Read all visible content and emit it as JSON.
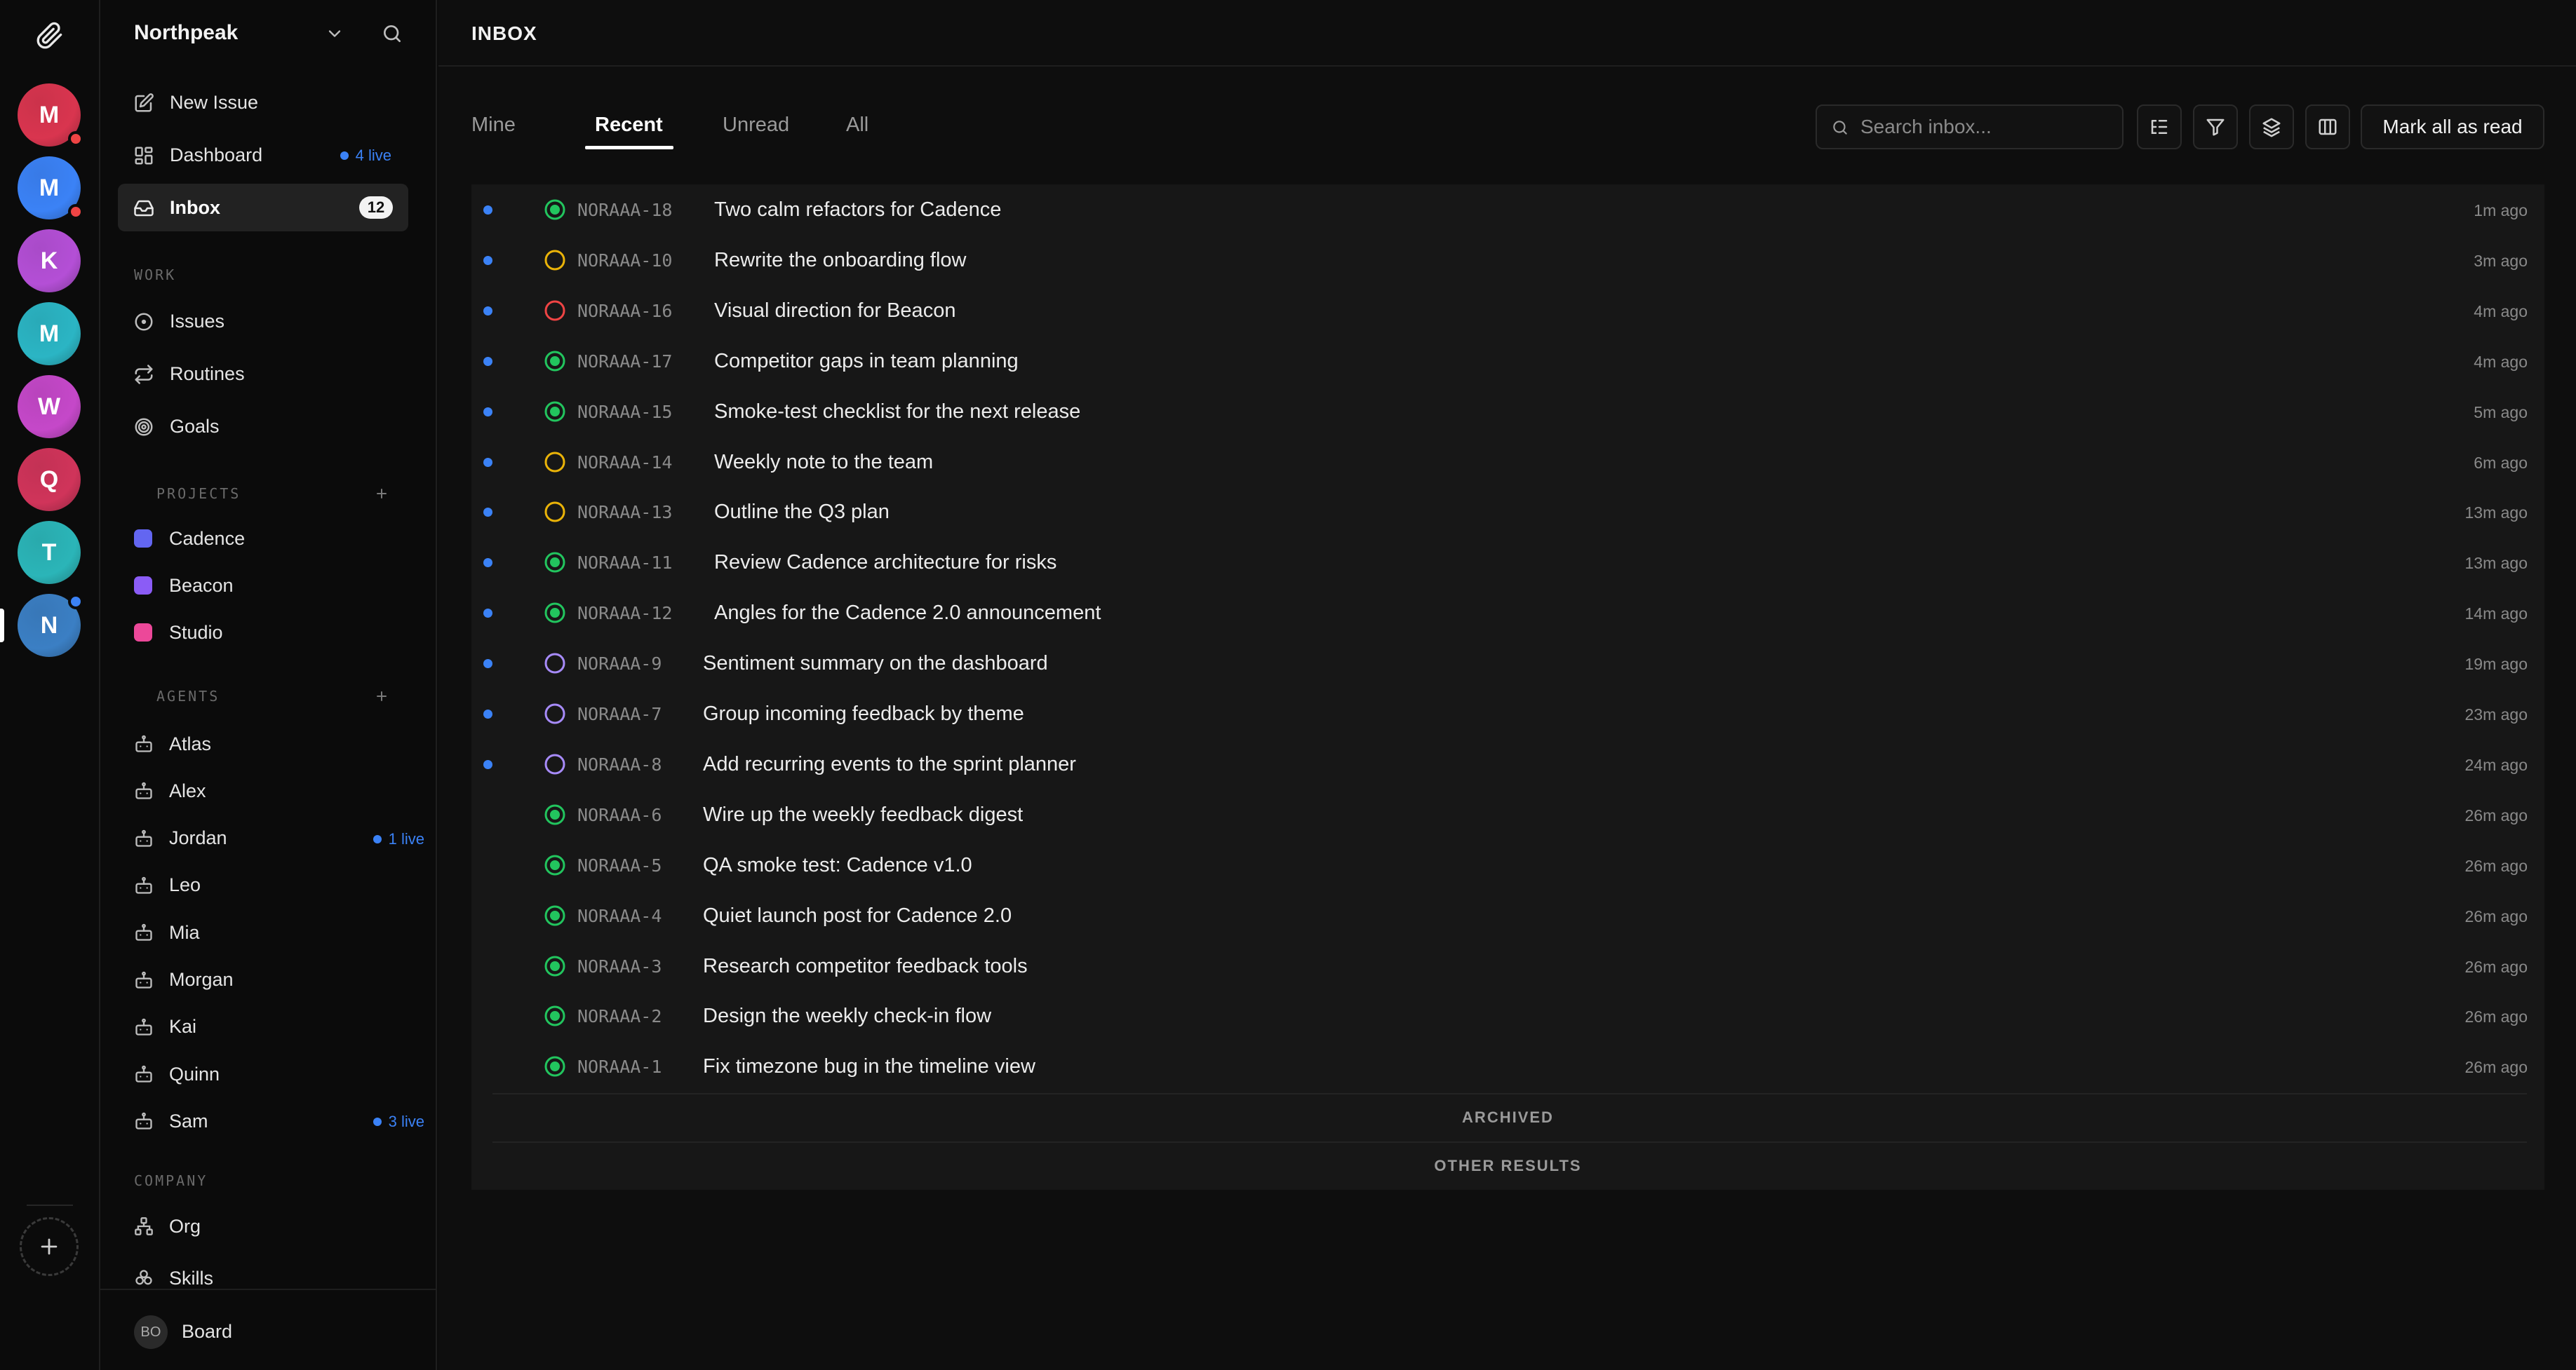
{
  "rail": {
    "avatars": [
      {
        "letter": "M",
        "color": "#d9354f",
        "dot": "#ef4444"
      },
      {
        "letter": "M",
        "color": "#3b82f6",
        "dot": "#ef4444"
      },
      {
        "letter": "K",
        "color": "#b44fd6",
        "dot": ""
      },
      {
        "letter": "M",
        "color": "#2bb5c4",
        "dot": ""
      },
      {
        "letter": "W",
        "color": "#c548c9",
        "dot": ""
      },
      {
        "letter": "Q",
        "color": "#d0345a",
        "dot": ""
      },
      {
        "letter": "T",
        "color": "#2bb5b8",
        "dot": ""
      },
      {
        "letter": "N",
        "color": "#3b7fc4",
        "dot": "#3b82f6"
      }
    ]
  },
  "sidebar": {
    "workspace": "Northpeak",
    "nav": [
      {
        "label": "New Issue",
        "icon": "edit-icon"
      },
      {
        "label": "Dashboard",
        "icon": "dashboard-icon",
        "live": "4 live"
      },
      {
        "label": "Inbox",
        "icon": "inbox-icon",
        "count": "12"
      }
    ],
    "work_title": "WORK",
    "work": [
      {
        "label": "Issues",
        "icon": "issues-icon"
      },
      {
        "label": "Routines",
        "icon": "routines-icon"
      },
      {
        "label": "Goals",
        "icon": "goals-icon"
      }
    ],
    "projects_title": "PROJECTS",
    "projects": [
      {
        "label": "Cadence",
        "color": "#6366f1"
      },
      {
        "label": "Beacon",
        "color": "#8b5cf6"
      },
      {
        "label": "Studio",
        "color": "#ec4899"
      }
    ],
    "agents_title": "AGENTS",
    "agents": [
      {
        "label": "Atlas",
        "live": ""
      },
      {
        "label": "Alex",
        "live": ""
      },
      {
        "label": "Jordan",
        "live": "1 live"
      },
      {
        "label": "Leo",
        "live": ""
      },
      {
        "label": "Mia",
        "live": ""
      },
      {
        "label": "Morgan",
        "live": ""
      },
      {
        "label": "Kai",
        "live": ""
      },
      {
        "label": "Quinn",
        "live": ""
      },
      {
        "label": "Sam",
        "live": "3 live"
      }
    ],
    "company_title": "COMPANY",
    "company": [
      {
        "label": "Org",
        "icon": "org-icon"
      },
      {
        "label": "Skills",
        "icon": "skills-icon"
      }
    ],
    "footer": {
      "initials": "BO",
      "label": "Board"
    }
  },
  "main": {
    "title": "INBOX",
    "tabs": [
      "Mine",
      "Recent",
      "Unread",
      "All"
    ],
    "search_placeholder": "Search inbox...",
    "mark_all": "Mark all as read",
    "archived": "ARCHIVED",
    "other_results": "OTHER RESULTS",
    "status_colors": {
      "done": "#22c55e",
      "todo": "#eab308",
      "blocked": "#ef4444",
      "backlog": "#a78bfa"
    },
    "items": [
      {
        "id": "NORAAA-18",
        "title": "Two calm refactors for Cadence",
        "time": "1m ago",
        "status": "done",
        "unread": true
      },
      {
        "id": "NORAAA-10",
        "title": "Rewrite the onboarding flow",
        "time": "3m ago",
        "status": "todo",
        "unread": true
      },
      {
        "id": "NORAAA-16",
        "title": "Visual direction for Beacon",
        "time": "4m ago",
        "status": "blocked",
        "unread": true
      },
      {
        "id": "NORAAA-17",
        "title": "Competitor gaps in team planning",
        "time": "4m ago",
        "status": "done",
        "unread": true
      },
      {
        "id": "NORAAA-15",
        "title": "Smoke-test checklist for the next release",
        "time": "5m ago",
        "status": "done",
        "unread": true
      },
      {
        "id": "NORAAA-14",
        "title": "Weekly note to the team",
        "time": "6m ago",
        "status": "todo",
        "unread": true
      },
      {
        "id": "NORAAA-13",
        "title": "Outline the Q3 plan",
        "time": "13m ago",
        "status": "todo",
        "unread": true
      },
      {
        "id": "NORAAA-11",
        "title": "Review Cadence architecture for risks",
        "time": "13m ago",
        "status": "done",
        "unread": true
      },
      {
        "id": "NORAAA-12",
        "title": "Angles for the Cadence 2.0 announcement",
        "time": "14m ago",
        "status": "done",
        "unread": true
      },
      {
        "id": "NORAAA-9",
        "title": "Sentiment summary on the dashboard",
        "time": "19m ago",
        "status": "backlog",
        "unread": true
      },
      {
        "id": "NORAAA-7",
        "title": "Group incoming feedback by theme",
        "time": "23m ago",
        "status": "backlog",
        "unread": true
      },
      {
        "id": "NORAAA-8",
        "title": "Add recurring events to the sprint planner",
        "time": "24m ago",
        "status": "backlog",
        "unread": true
      },
      {
        "id": "NORAAA-6",
        "title": "Wire up the weekly feedback digest",
        "time": "26m ago",
        "status": "done",
        "unread": false
      },
      {
        "id": "NORAAA-5",
        "title": "QA smoke test: Cadence v1.0",
        "time": "26m ago",
        "status": "done",
        "unread": false
      },
      {
        "id": "NORAAA-4",
        "title": "Quiet launch post for Cadence 2.0",
        "time": "26m ago",
        "status": "done",
        "unread": false
      },
      {
        "id": "NORAAA-3",
        "title": "Research competitor feedback tools",
        "time": "26m ago",
        "status": "done",
        "unread": false
      },
      {
        "id": "NORAAA-2",
        "title": "Design the weekly check-in flow",
        "time": "26m ago",
        "status": "done",
        "unread": false
      },
      {
        "id": "NORAAA-1",
        "title": "Fix timezone bug in the timeline view",
        "time": "26m ago",
        "status": "done",
        "unread": false
      }
    ]
  }
}
